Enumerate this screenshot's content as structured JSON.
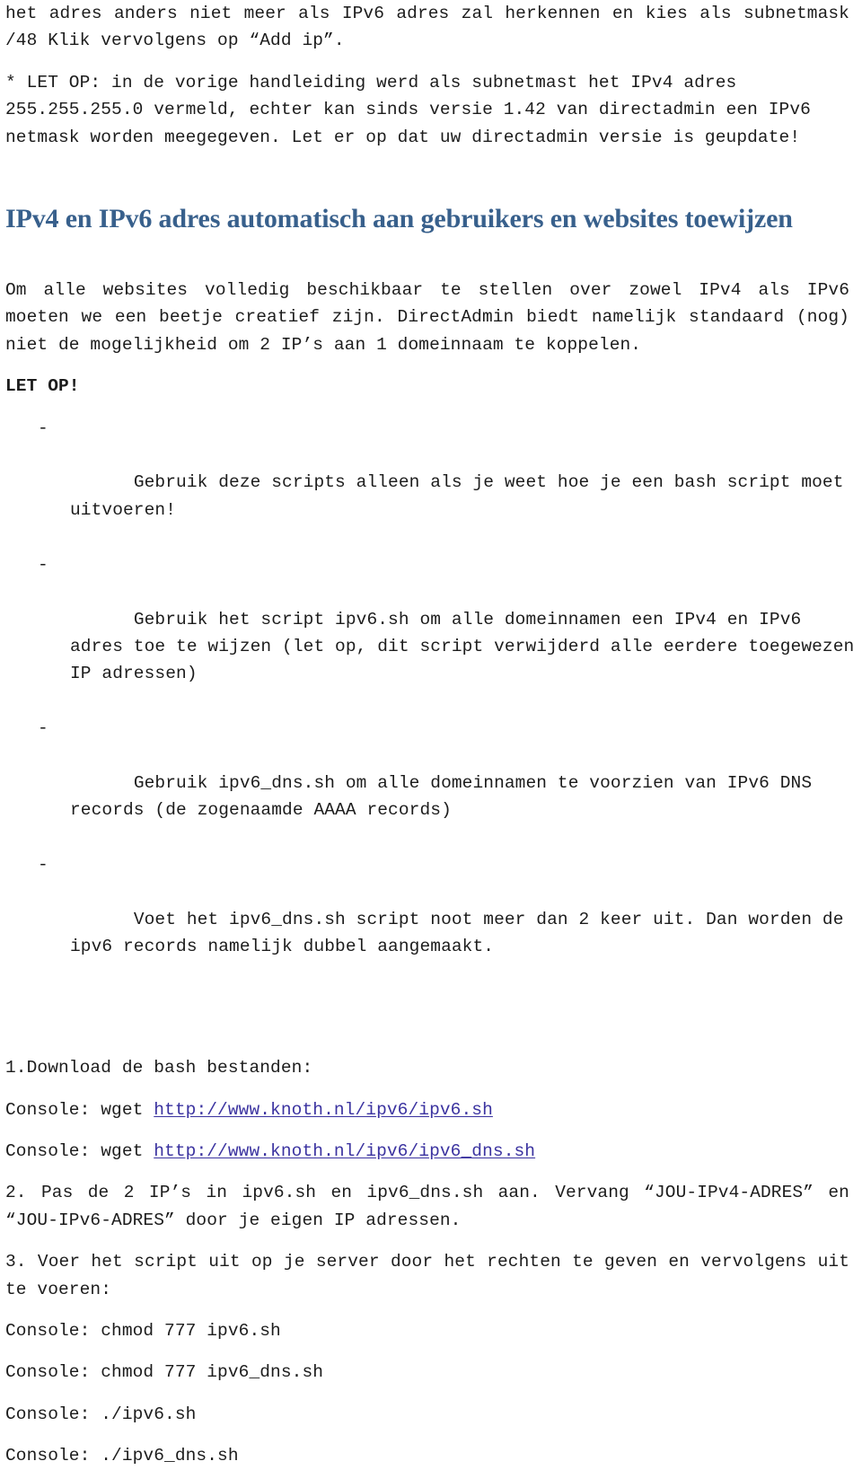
{
  "document": {
    "title": "IPv6 handleiding — DirectAdmin",
    "heading_color": "#38608c",
    "link_color": "#3b33a0",
    "body_color": "#1c1c1c",
    "background_color": "#ffffff"
  },
  "intro": {
    "paragraph_1": "het adres anders niet meer als IPv6 adres zal herkennen en kies als subnetmask /48 Klik vervolgens op “Add ip”.",
    "note_paragraph": "* LET OP: in de vorige handleiding werd als subnetmast het IPv4 adres 255.255.255.0 vermeld, echter kan sinds versie 1.42 van directadmin een IPv6 netmask worden meegegeven. Let er op dat uw directadmin versie is geupdate!"
  },
  "section": {
    "heading": "IPv4 en IPv6 adres automatisch aan gebruikers en websites toewijzen",
    "body_paragraph": "Om alle websites volledig beschikbaar te stellen over zowel IPv4 als IPv6 moeten we een beetje creatief zijn. DirectAdmin biedt namelijk standaard (nog) niet de mogelijkheid om 2 IP’s aan 1 domeinnaam te koppelen.",
    "warning_label": "LET OP!",
    "warning_bullets": [
      {
        "marker": "-",
        "text": "Gebruik deze scripts alleen als je weet hoe je een bash script moet uitvoeren!"
      },
      {
        "marker": "-",
        "text": "Gebruik het script ipv6.sh om alle domeinnamen een IPv4 en IPv6 adres toe te wijzen (let op, dit script verwijderd alle eerdere toegewezen IP adressen)"
      },
      {
        "marker": "-",
        "text": "Gebruik ipv6_dns.sh om alle domeinnamen te voorzien van IPv6 DNS records (de zogenaamde AAAA records)"
      },
      {
        "marker": "-",
        "text": "Voet het ipv6_dns.sh script noot meer dan 2 keer uit. Dan worden de ipv6 records namelijk dubbel aangemaakt."
      }
    ]
  },
  "steps": {
    "step1": {
      "text": "1.Download de bash bestanden:",
      "commands": [
        {
          "prefix": "Console: wget ",
          "link": "http://www.knoth.nl/ipv6/ipv6.sh"
        },
        {
          "prefix": "Console: wget ",
          "link": "http://www.knoth.nl/ipv6/ipv6_dns.sh"
        }
      ]
    },
    "step2": {
      "text": "2. Pas de 2 IP’s in ipv6.sh en ipv6_dns.sh aan. Vervang “JOU-IPv4-ADRES” en “JOU-IPv6-ADRES” door je eigen IP adressen."
    },
    "step3": {
      "text": "3. Voer het script uit op je server door het rechten te geven en vervolgens uit te voeren:",
      "commands": [
        "Console: chmod 777 ipv6.sh",
        "Console: chmod 777 ipv6_dns.sh",
        "Console: ./ipv6.sh",
        "Console: ./ipv6_dns.sh"
      ]
    }
  }
}
